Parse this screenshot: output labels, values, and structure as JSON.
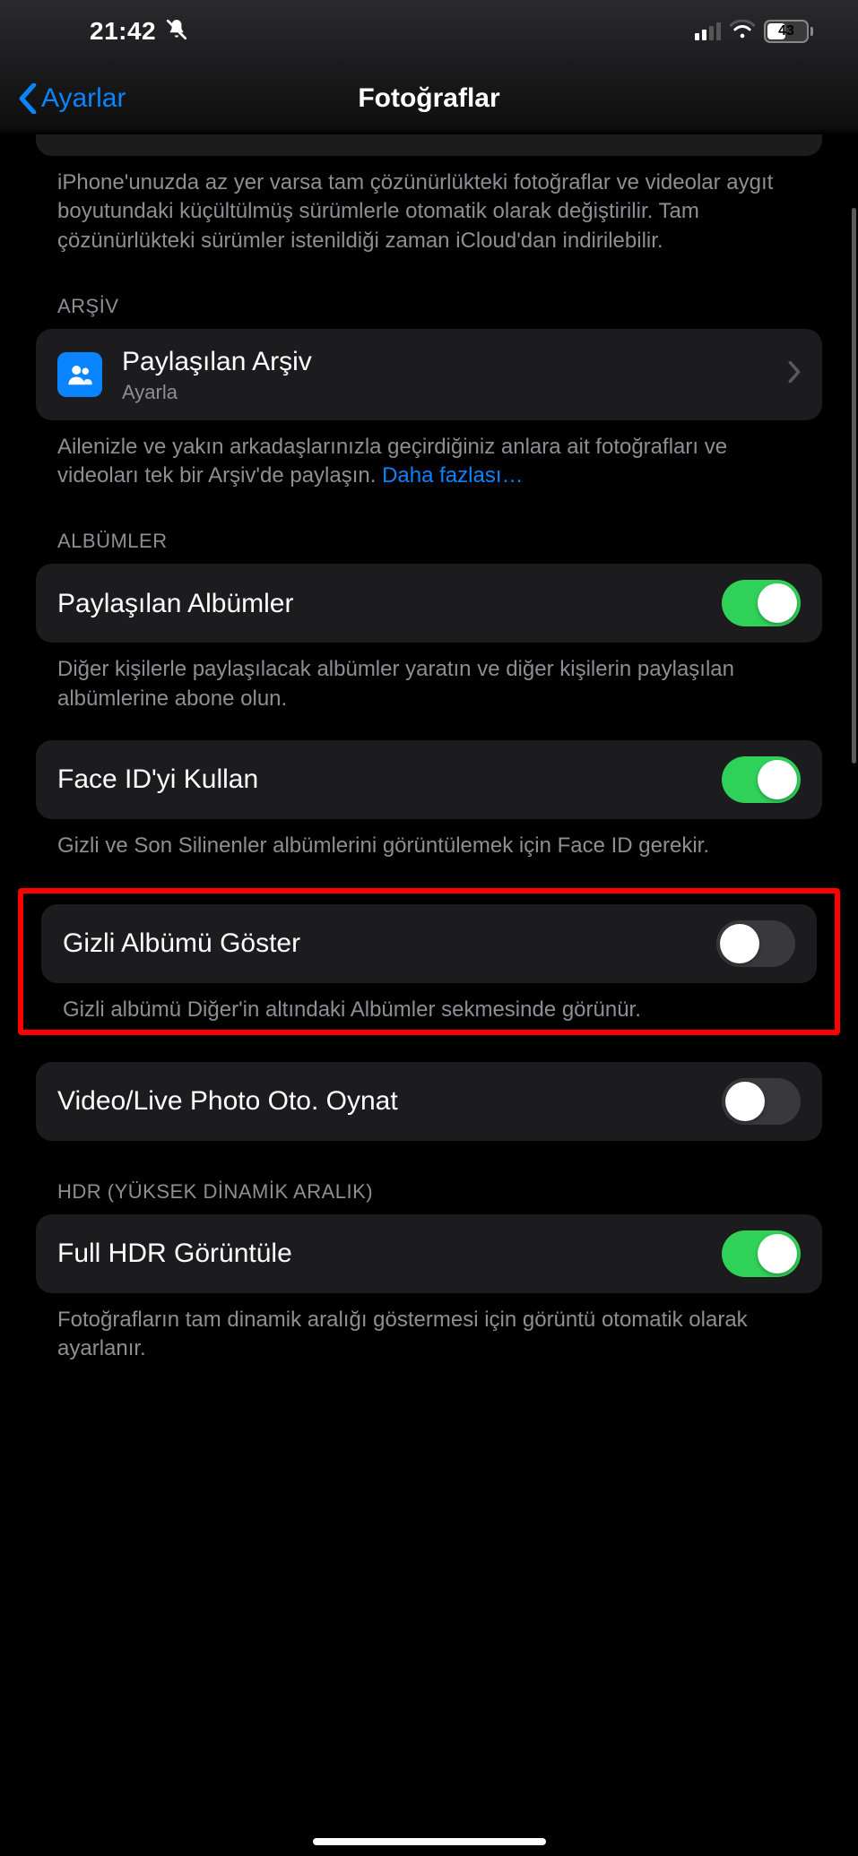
{
  "status": {
    "time": "21:42",
    "battery_percent": "43"
  },
  "nav": {
    "back_label": "Ayarlar",
    "title": "Fotoğraflar"
  },
  "intro_footer": "iPhone'unuzda az yer varsa tam çözünürlükteki fotoğraflar ve videolar aygıt boyutundaki küçültülmüş sürümlerle otomatik olarak değiştirilir. Tam çözünürlükteki sürümler istenildiği zaman iCloud'dan indirilebilir.",
  "archive": {
    "header": "ARŞİV",
    "row_title": "Paylaşılan Arşiv",
    "row_sub": "Ayarla",
    "footer_text": "Ailenizle ve yakın arkadaşlarınızla geçirdiğiniz anlara ait fotoğrafları ve videoları tek bir Arşiv'de paylaşın. ",
    "footer_link": "Daha fazlası…"
  },
  "albums": {
    "header": "ALBÜMLER",
    "shared_albums": {
      "label": "Paylaşılan Albümler",
      "on": true,
      "footer": "Diğer kişilerle paylaşılacak albümler yaratın ve diğer kişilerin paylaşılan albümlerine abone olun."
    },
    "face_id": {
      "label": "Face ID'yi Kullan",
      "on": true,
      "footer": "Gizli ve Son Silinenler albümlerini görüntülemek için Face ID gerekir."
    },
    "hidden_album": {
      "label": "Gizli Albümü Göster",
      "on": false,
      "footer": "Gizli albümü Diğer'in altındaki Albümler sekmesinde görünür."
    },
    "autoplay": {
      "label": "Video/Live Photo Oto. Oynat",
      "on": false
    }
  },
  "hdr": {
    "header": "HDR (YÜKSEK DİNAMİK ARALIK)",
    "full_hdr": {
      "label": "Full HDR Görüntüle",
      "on": true,
      "footer": "Fotoğrafların tam dinamik aralığı göstermesi için görüntü otomatik olarak ayarlanır."
    }
  }
}
